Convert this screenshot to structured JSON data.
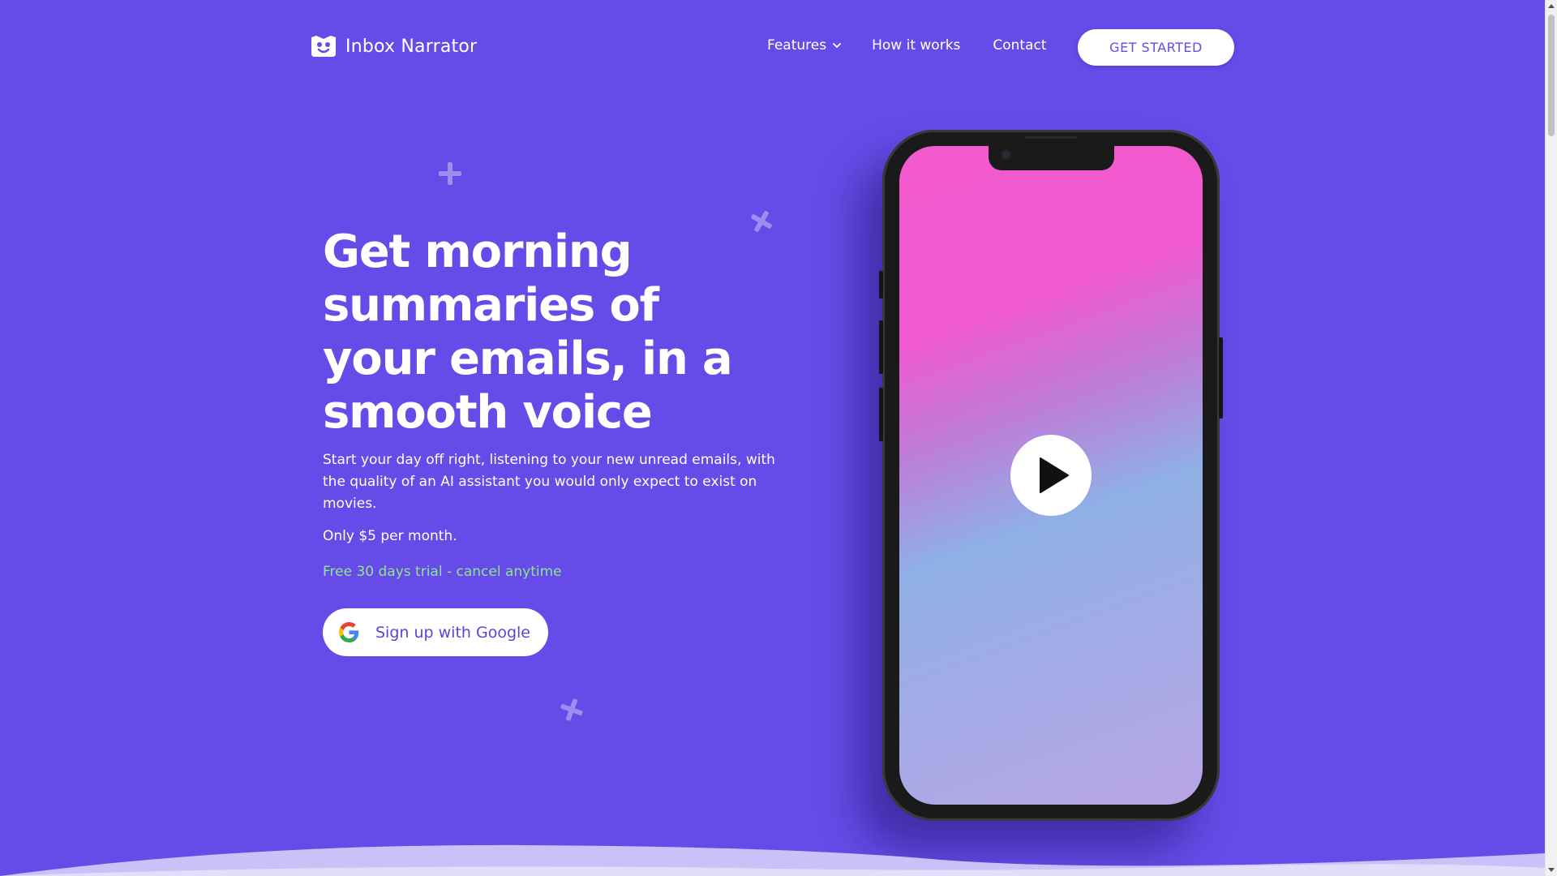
{
  "brand": {
    "name": "Inbox Narrator",
    "logo_icon": "robot-face-icon"
  },
  "nav": {
    "features_label": "Features",
    "how_it_works_label": "How it works",
    "contact_label": "Contact",
    "cta_label": "GET STARTED"
  },
  "hero": {
    "title": "Get morning summaries of your emails, in a smooth voice",
    "description": "Start your day off right, listening to your new unread emails, with the quality of an AI assistant you would only expect to exist on movies.",
    "price": "Only $5 per month.",
    "trial": "Free 30 days trial - cancel anytime",
    "signup_label": "Sign up with Google"
  },
  "phone": {
    "play_icon": "play-icon"
  },
  "colors": {
    "background": "#674BE8",
    "accent_text": "#5A44D6",
    "trial_green": "#8FE58E",
    "screen_pink": "#F25ACE",
    "screen_blue": "#8FB0E6",
    "screen_lavender": "#B9A4E6",
    "wave_light": "#C9C1F7"
  }
}
